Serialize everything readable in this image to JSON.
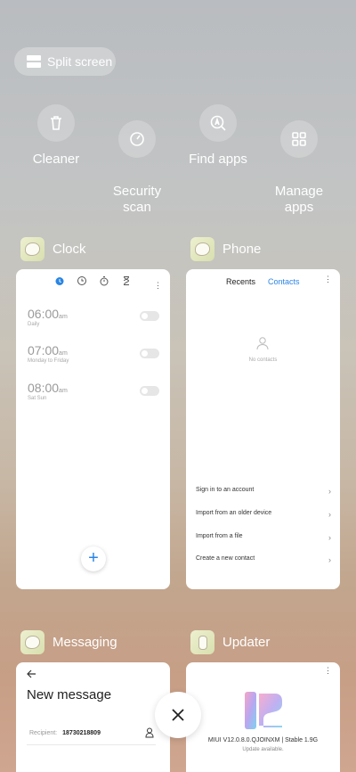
{
  "split_screen": {
    "label": "Split screen"
  },
  "quick_actions": [
    {
      "label": "Cleaner",
      "icon": "trash-icon"
    },
    {
      "label": "Security\nscan",
      "icon": "security-icon"
    },
    {
      "label": "Find apps",
      "icon": "find-apps-icon"
    },
    {
      "label": "Manage\napps",
      "icon": "grid-icon"
    }
  ],
  "apps": {
    "clock": {
      "name": "Clock",
      "alarms": [
        {
          "time": "06:00",
          "ampm": "am",
          "repeat": "Daily"
        },
        {
          "time": "07:00",
          "ampm": "am",
          "repeat": "Monday to Friday"
        },
        {
          "time": "08:00",
          "ampm": "am",
          "repeat": "Sat Sun"
        }
      ],
      "add_label": "+"
    },
    "phone": {
      "name": "Phone",
      "tabs": [
        "Recents",
        "Contacts"
      ],
      "empty_text": "No contacts",
      "options": [
        "Sign in to an account",
        "Import from an older device",
        "Import from a file",
        "Create a new contact"
      ]
    },
    "messaging": {
      "name": "Messaging",
      "title": "New message",
      "recipient_label": "Recipient:",
      "recipient_value": "18730218809"
    },
    "updater": {
      "name": "Updater",
      "version": "MIUI V12.0.8.0.QJOINXM | Stable 1.9G",
      "status": "Update available."
    }
  },
  "colors": {
    "accent": "#2b85e4"
  }
}
